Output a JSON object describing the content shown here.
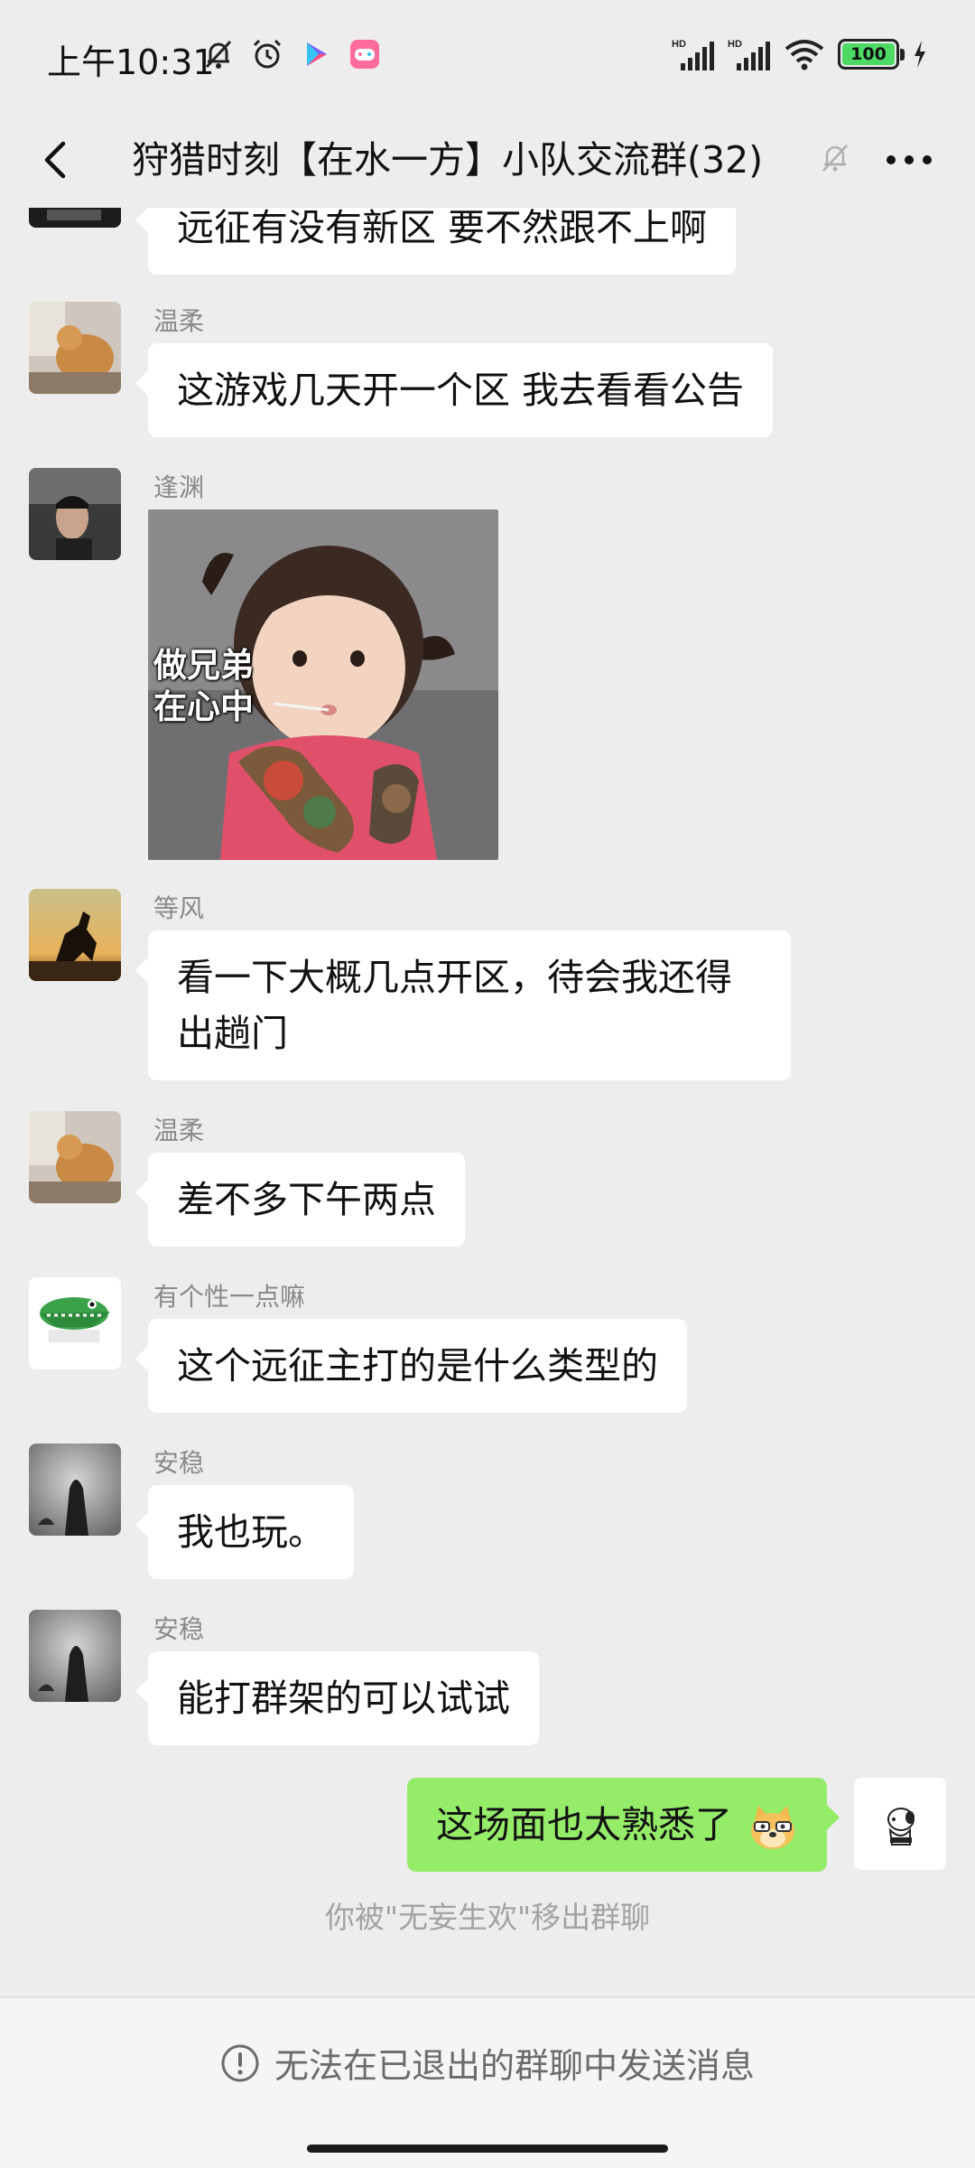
{
  "status_bar": {
    "time": "上午10:31",
    "battery": "100",
    "network_labels": [
      "HD",
      "HD"
    ]
  },
  "header": {
    "title": "狩猎时刻【在水一方】小队交流群(32)"
  },
  "messages": [
    {
      "sender": "",
      "text": "远征有没有新区 要不然跟不上啊"
    },
    {
      "sender": "温柔",
      "text": "这游戏几天开一个区 我去看看公告"
    },
    {
      "sender": "逢渊",
      "sticker_caption": "做兄弟\n在心中"
    },
    {
      "sender": "等风",
      "text": "看一下大概几点开区，待会我还得出趟门"
    },
    {
      "sender": "温柔",
      "text": "差不多下午两点"
    },
    {
      "sender": "有个性一点嘛",
      "text": "这个远征主打的是什么类型的"
    },
    {
      "sender": "安稳",
      "text": "我也玩。"
    },
    {
      "sender": "安稳",
      "text": "能打群架的可以试试"
    },
    {
      "sender": "me",
      "text": "这场面也太熟悉了"
    }
  ],
  "system_note": "你被\"无妄生欢\"移出群聊",
  "bottom_notice": "无法在已退出的群聊中发送消息",
  "colors": {
    "background": "#ededed",
    "bubble_other": "#ffffff",
    "bubble_self": "#95ec69",
    "sender_name": "#8a8a8a"
  }
}
